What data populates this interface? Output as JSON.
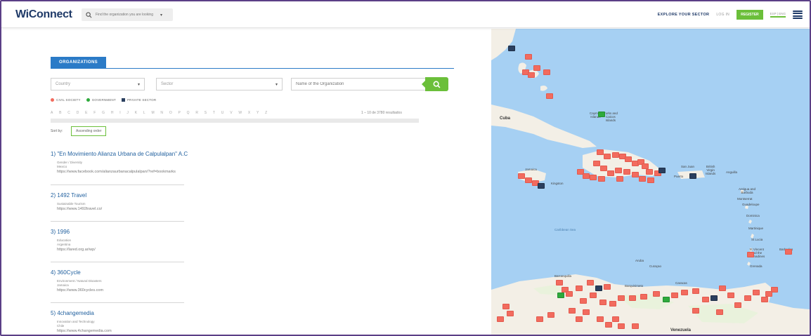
{
  "header": {
    "logo": "WiConnect",
    "search_placeholder": "Find the organization you are looking",
    "nav": {
      "explore": "EXPLORE YOUR SECTOR",
      "login": "LOG IN",
      "register": "REGISTER",
      "lang": "ESP | ENG"
    }
  },
  "filters": {
    "tab": "ORGANIZATIONS",
    "country": "Country",
    "sector": "Sector",
    "name_placeholder": "Name of the Organization"
  },
  "legend": [
    {
      "label": "CIVIL SOCIETY",
      "color": "#f26b5e",
      "shape": "circle"
    },
    {
      "label": "GOVERNMENT",
      "color": "#2eaa3c",
      "shape": "circle"
    },
    {
      "label": "PRIVATE SECTOR",
      "color": "#2a3f5f",
      "shape": "square"
    }
  ],
  "alphabet": [
    "A",
    "B",
    "C",
    "D",
    "E",
    "F",
    "G",
    "H",
    "I",
    "J",
    "K",
    "L",
    "M",
    "N",
    "O",
    "P",
    "Q",
    "R",
    "S",
    "T",
    "U",
    "V",
    "W",
    "X",
    "Y",
    "Z"
  ],
  "results": "1 – 10 de 3780 resultados",
  "sort": {
    "label": "Sort by:",
    "value": "Ascending order"
  },
  "organizations": [
    {
      "title": "1) \"En Movimiento Alianza Urbana de Calpulalpan\" A.C",
      "lines": [
        "Gender / Diversity",
        "Mexico"
      ],
      "url": "https://www.facebook.com/alianzaurbanacalpulalpan/?ref=bookmarks"
    },
    {
      "title": "2) 1492 Travel",
      "lines": [
        "Sustainable Tourism"
      ],
      "url": "https://www.1492travel.co/"
    },
    {
      "title": "3) 1996",
      "lines": [
        "Education",
        "Argentina"
      ],
      "url": "https://lared.org.ar/wp/"
    },
    {
      "title": "4) 360Cycle",
      "lines": [
        "Environment / Natural Disasters",
        "Jamaica"
      ],
      "url": "https://www.360cycles.com"
    },
    {
      "title": "5) 4changemedia",
      "lines": [
        "Innovation and Technology",
        "Chile"
      ],
      "url": "https://www.4changemedia.com"
    }
  ],
  "map": {
    "labels": {
      "cuba": "Cuba",
      "cayman": "Cayman\nIslands",
      "turks": "Turks and\nCaicos\nIslands",
      "sanjuan": "San Juan",
      "puerto": "Puerto",
      "british": "British\nVirgin\nIslands",
      "anguilla": "Anguilla",
      "antigua": "Antigua and\nBarbuda",
      "montserrat": "Montserrat",
      "guadeloupe": "Guadeloupe",
      "dominica": "Dominica",
      "martinique": "Martinique",
      "stlucia": "St Lucia",
      "stvincent": "St Vincent\nand the\nGrenadines",
      "barbados": "Barbados",
      "grenada": "Grenada",
      "sea": "Caribbean Sea",
      "aruba": "Aruba",
      "curacao": "Curaçao",
      "barranquilla": "Barranquilla",
      "barquisimeto": "Barquisimeto",
      "caracas": "Caracas",
      "venezuela": "Venezuela",
      "kingston": "Kingston",
      "jamaica": "Jamaica"
    }
  }
}
